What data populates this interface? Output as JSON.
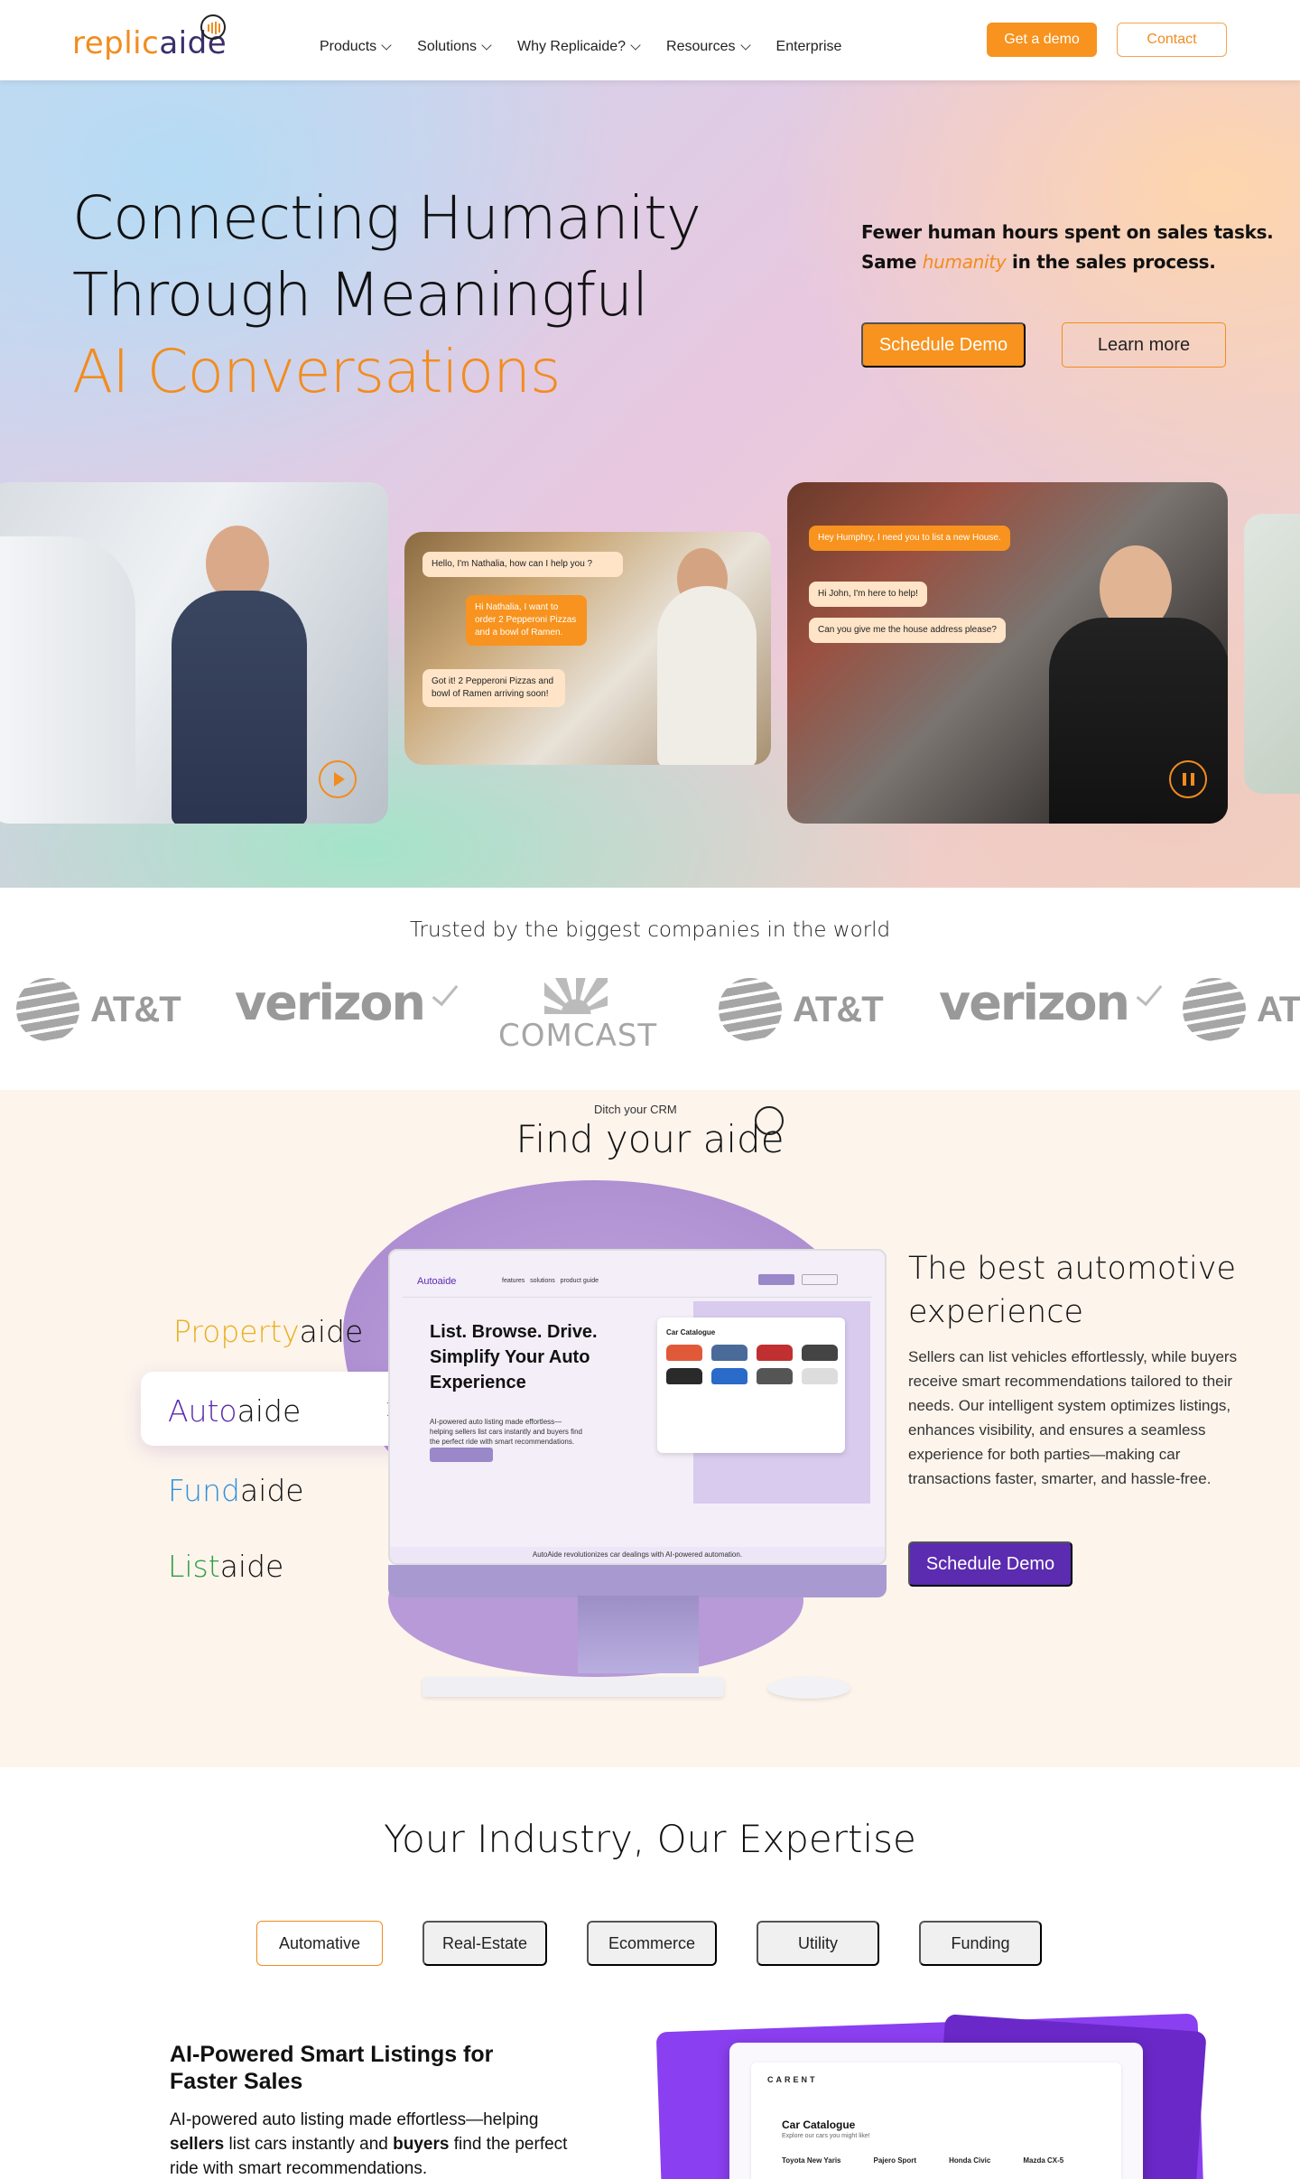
{
  "nav": {
    "logo_a": "replic",
    "logo_b": "aide",
    "menu": [
      {
        "label": "Products",
        "dropdown": true
      },
      {
        "label": "Solutions",
        "dropdown": true
      },
      {
        "label": "Why Replicaide?",
        "dropdown": true
      },
      {
        "label": "Resources",
        "dropdown": true
      },
      {
        "label": "Enterprise",
        "dropdown": false
      }
    ],
    "demo_label": "Get a demo",
    "contact_label": "Contact"
  },
  "hero": {
    "title_line1": "Connecting Humanity",
    "title_line2": "Through Meaningful",
    "title_accent": "AI Conversations",
    "tag_line1": "Fewer human hours spent on sales tasks.",
    "tag_pre": "Same ",
    "tag_em": "humanity",
    "tag_post": " in the sales process.",
    "schedule_label": "Schedule Demo",
    "learn_label": "Learn more",
    "card2_bubbles": [
      "Hello, I'm Nathalia, how can I help you ?",
      "Hi Nathalia, I want to order 2 Pepperoni Pizzas and a bowl of Ramen.",
      "Got it! 2 Pepperoni Pizzas and bowl of Ramen arriving soon!"
    ],
    "card3_bubbles": [
      "Hey Humphry, I need you to list a new House.",
      "Hi John, I'm here to help!",
      "Can you give me the house address please?"
    ]
  },
  "trusted": {
    "title": "Trusted by the biggest companies in the world",
    "logos": [
      "AT&T",
      "verizon",
      "COMCAST",
      "AT&T",
      "verizon",
      "AT&T"
    ]
  },
  "find": {
    "pre": "Ditch your CRM",
    "title": "Find your aide",
    "aides": [
      {
        "prefix": "Property",
        "suffix": "aide",
        "color": "#e8b020"
      },
      {
        "prefix": "Auto",
        "suffix": "aide",
        "color": "#5b2bb0"
      },
      {
        "prefix": "Fund",
        "suffix": "aide",
        "color": "#2f8fd8"
      },
      {
        "prefix": "List",
        "suffix": "aide",
        "color": "#2f9e44"
      }
    ],
    "screen": {
      "brand": "Autoaide",
      "nav": "features   solutions   product guide",
      "heading": "List. Browse. Drive. Simplify Your Auto Experience",
      "para": "AI-powered auto listing made effortless—helping sellers list cars instantly and buyers find the perfect ride with smart recommendations.",
      "card_title": "Car Catalogue",
      "footer": "AutoAide revolutionizes car dealings with AI-powered automation."
    },
    "best_title": "The best automotive experience",
    "best_desc": "Sellers can list vehicles effortlessly, while buyers receive smart recommendations tailored to their needs. Our intelligent system optimizes listings, enhances visibility, and ensures a seamless experience for both parties—making car transactions faster, smarter, and hassle-free.",
    "schedule_label": "Schedule Demo"
  },
  "industry": {
    "title": "Your Industry, Our Expertise",
    "tabs": [
      "Automative",
      "Real-Estate",
      "Ecommerce",
      "Utility",
      "Funding"
    ],
    "active_tab": "Automative",
    "feature_title": "AI-Powered Smart Listings for Faster Sales",
    "desc_1": "AI-powered auto listing made effortless—helping ",
    "desc_b1": "sellers",
    "desc_2": " list cars instantly and ",
    "desc_b2": "buyers",
    "desc_3": " find the perfect ride with smart recommendations.",
    "mock": {
      "brand": "CARENT",
      "title": "Car Catalogue",
      "sub": "Explore our cars you might like!",
      "cars": [
        "Toyota New Yaris",
        "Pajero Sport",
        "Honda Civic",
        "Mazda CX-5"
      ]
    }
  }
}
